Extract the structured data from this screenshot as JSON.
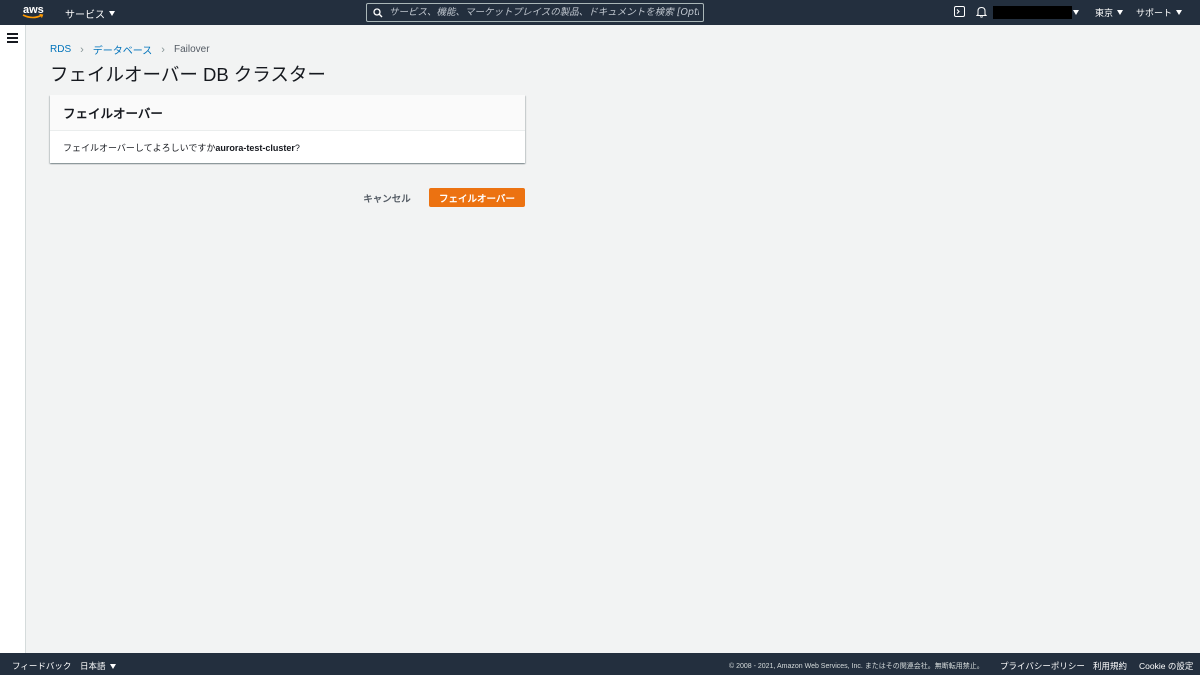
{
  "topnav": {
    "logo_text": "aws",
    "services_label": "サービス",
    "search_placeholder": "サービス、機能、マーケットプレイスの製品、ドキュメントを検索 [Option+S]",
    "region_label": "東京",
    "support_label": "サポート"
  },
  "breadcrumb": {
    "items": [
      "RDS",
      "データベース",
      "Failover"
    ]
  },
  "page": {
    "title": "フェイルオーバー DB クラスター"
  },
  "panel": {
    "header": "フェイルオーバー",
    "question_prefix": "フェイルオーバーしてよろしいですか",
    "cluster_name": "aurora-test-cluster",
    "question_suffix": "?"
  },
  "actions": {
    "cancel_label": "キャンセル",
    "confirm_label": "フェイルオーバー"
  },
  "footer": {
    "feedback_label": "フィードバック",
    "language_label": "日本語",
    "copyright": "© 2008 - 2021, Amazon Web Services, Inc. またはその関連会社。無断転用禁止。",
    "privacy_label": "プライバシーポリシー",
    "terms_label": "利用規約",
    "cookie_label": "Cookie の設定"
  },
  "colors": {
    "nav_bg": "#232f3e",
    "primary_button": "#ec7211",
    "link": "#0073bb",
    "page_bg": "#f2f3f3"
  }
}
